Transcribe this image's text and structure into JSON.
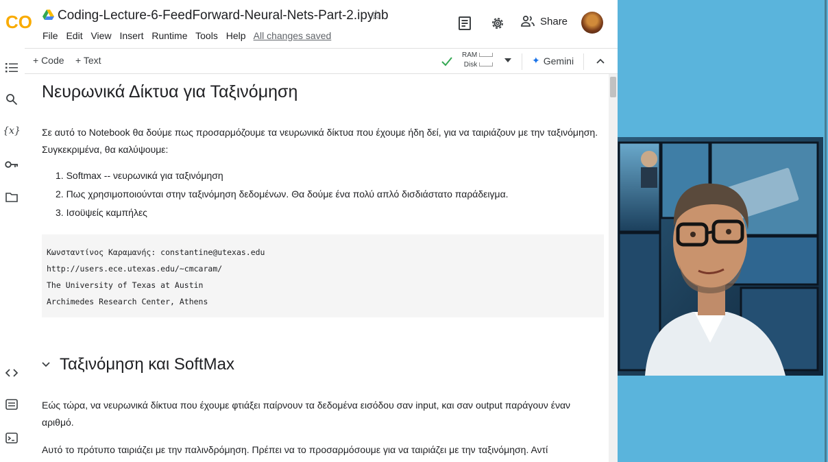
{
  "header": {
    "notebook_title": "Coding-Lecture-6-FeedForward-Neural-Nets-Part-2.ipynb",
    "logo_text": "CO",
    "menu": [
      "File",
      "Edit",
      "View",
      "Insert",
      "Runtime",
      "Tools",
      "Help"
    ],
    "save_status": "All changes saved",
    "share_label": "Share"
  },
  "cellbar": {
    "add_code": "+ Code",
    "add_text": "+ Text",
    "ram_label": "RAM",
    "disk_label": "Disk",
    "gemini_label": "Gemini"
  },
  "notebook": {
    "title": "Νευρωνικά Δίκτυα για Ταξινόμηση",
    "intro": "Σε αυτό το Notebook θα δούμε πως προσαρμόζουμε τα νευρωνικά δίκτυα που έχουμε ήδη δεί, για να ταιριάζουν με την ταξινόμηση. Συγκεκριμένα, θα καλύψουμε:",
    "list": [
      "1. Softmax -- νευρωνικά για ταξινόμηση",
      "2. Πως χρησιμοποιούνται στην ταξινόμηση δεδομένων. Θα δούμε ένα πολύ απλό δισδιάστατο παράδειγμα.",
      "3. Ισοϋψείς καμπήλες"
    ],
    "code_lines": [
      "Κωνσταντίνος Καραμανής: constantine@utexas.edu",
      "http://users.ece.utexas.edu/~cmcaram/",
      "The University of Texas at Austin",
      "Archimedes Research Center, Athens"
    ],
    "section_title": "Ταξινόμηση και SoftMax",
    "section_p1": "Εώς τώρα, να νευρωνικά δίκτυα που έχουμε φτιάξει παίρνουν τα δεδομένα εισόδου σαν input, και σαν output παράγουν έναν αριθμό.",
    "section_p2": "Αυτό το πρότυπο ταιριάζει με την παλινδρόμηση. Πρέπει να το προσαρμόσουμε για να ταιριάζει με την ταξινόμηση. Αντί"
  },
  "icons": {
    "sidebar_top": [
      "toc-icon",
      "search-icon",
      "variables-icon",
      "key-icon",
      "folder-icon"
    ],
    "sidebar_bottom": [
      "code-snippets-icon",
      "command-palette-icon",
      "terminal-icon"
    ],
    "variables_glyph": "{x}"
  },
  "colors": {
    "accent": "#1a73e8",
    "check": "#34a853",
    "logo_orange": "#f9ab00",
    "code_bg": "#f5f5f5",
    "frame_bg": "#5ab4dc"
  }
}
